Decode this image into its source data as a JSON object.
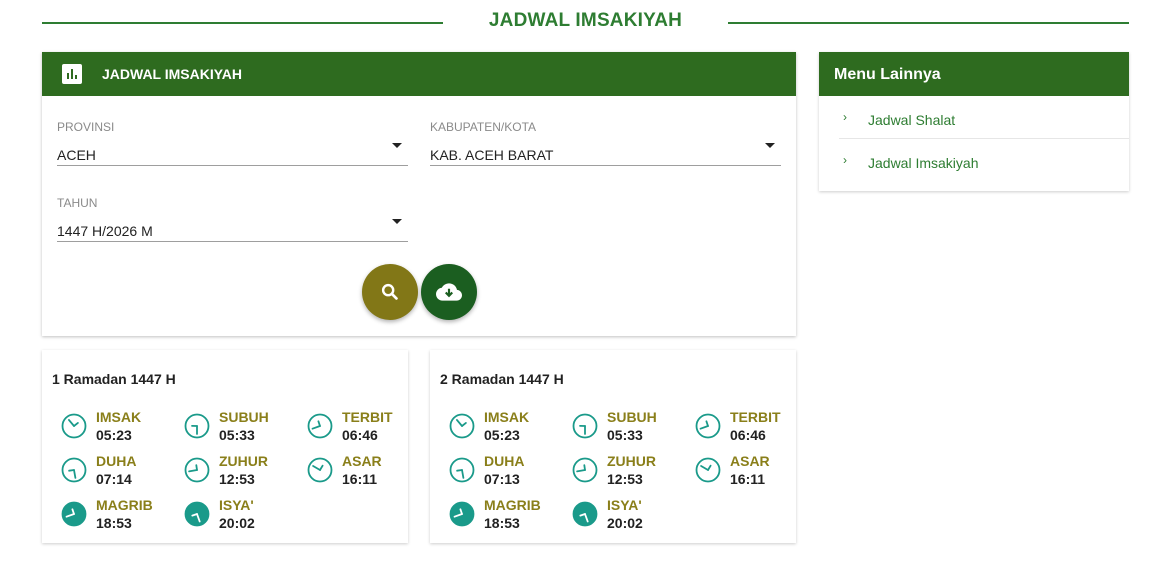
{
  "page": {
    "title": "JADWAL IMSAKIYAH"
  },
  "form": {
    "header_title": "JADWAL IMSAKIYAH",
    "provinsi": {
      "label": "PROVINSI",
      "value": "ACEH"
    },
    "kabupaten": {
      "label": "KABUPATEN/KOTA",
      "value": "KAB. ACEH BARAT"
    },
    "tahun": {
      "label": "TAHUN",
      "value": "1447 H/2026 M"
    },
    "search_icon": "search-icon",
    "download_icon": "cloud-download-icon"
  },
  "days": [
    {
      "title": "1 Ramadan 1447 H",
      "prayers": [
        {
          "name": "IMSAK",
          "time": "05:23"
        },
        {
          "name": "SUBUH",
          "time": "05:33"
        },
        {
          "name": "TERBIT",
          "time": "06:46"
        },
        {
          "name": "DUHA",
          "time": "07:14"
        },
        {
          "name": "ZUHUR",
          "time": "12:53"
        },
        {
          "name": "ASAR",
          "time": "16:11"
        },
        {
          "name": "MAGRIB",
          "time": "18:53"
        },
        {
          "name": "ISYA'",
          "time": "20:02"
        }
      ]
    },
    {
      "title": "2 Ramadan 1447 H",
      "prayers": [
        {
          "name": "IMSAK",
          "time": "05:23"
        },
        {
          "name": "SUBUH",
          "time": "05:33"
        },
        {
          "name": "TERBIT",
          "time": "06:46"
        },
        {
          "name": "DUHA",
          "time": "07:13"
        },
        {
          "name": "ZUHUR",
          "time": "12:53"
        },
        {
          "name": "ASAR",
          "time": "16:11"
        },
        {
          "name": "MAGRIB",
          "time": "18:53"
        },
        {
          "name": "ISYA'",
          "time": "20:02"
        }
      ]
    }
  ],
  "menu": {
    "title": "Menu Lainnya",
    "items": [
      {
        "label": "Jadwal Shalat"
      },
      {
        "label": "Jadwal Imsakiyah"
      }
    ]
  },
  "colors": {
    "primary": "#2e6b1f",
    "accent_olive": "#827717",
    "teal": "#1a9a8a",
    "prayer_name": "#8a7f1a"
  }
}
